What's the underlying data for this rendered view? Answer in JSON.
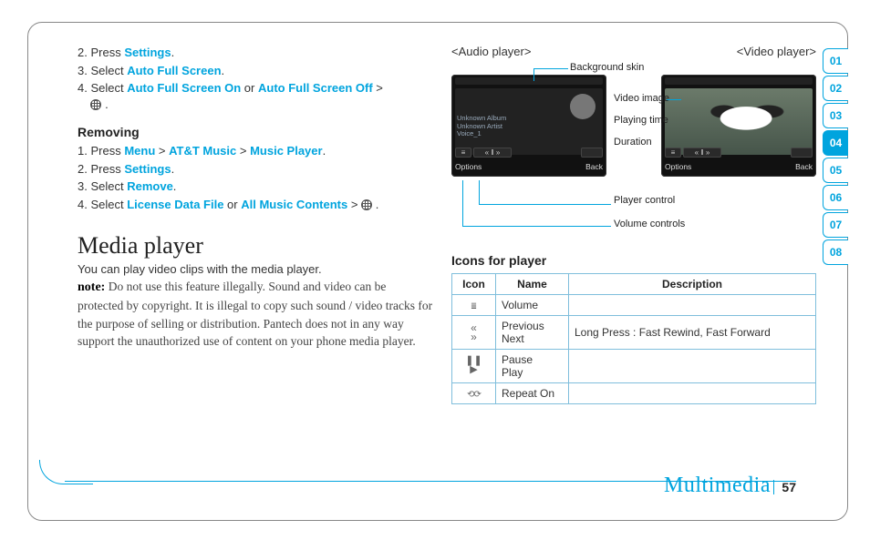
{
  "left": {
    "steps_top": [
      {
        "num": "2.",
        "pre": "Press ",
        "b1": "Settings",
        "post": "."
      },
      {
        "num": "3.",
        "pre": "Select ",
        "b1": "Auto Full Screen",
        "post": "."
      },
      {
        "num": "4.",
        "pre": "Select ",
        "b1": "Auto Full Screen On",
        "mid": " or ",
        "b2": "Auto Full Screen Off",
        "post": " > ",
        "globe": true
      }
    ],
    "removing_head": "Removing",
    "steps_removing": [
      {
        "num": "1.",
        "pre": "Press ",
        "b1": "Menu",
        "mid": " > ",
        "b2": "AT&T Music",
        "mid2": " > ",
        "b3": "Music Player",
        "post": "."
      },
      {
        "num": "2.",
        "pre": "Press ",
        "b1": "Settings",
        "post": "."
      },
      {
        "num": "3.",
        "pre": "Select ",
        "b1": "Remove",
        "post": "."
      },
      {
        "num": "4.",
        "pre": "Select ",
        "b1": "License Data File",
        "mid": " or ",
        "b2": "All Music Contents",
        "post": " > ",
        "globe": true
      }
    ],
    "h1": "Media player",
    "intro": "You can play video clips with the media player.",
    "note_lead": "note:",
    "note_body": " Do not use this feature illegally. Sound and video can be protected by copyright. It is illegal to copy such sound / video tracks for the purpose of selling or distribution. Pantech does not in any way support the unauthorized use of content on your phone media player."
  },
  "right": {
    "label_audio": "<Audio player>",
    "label_video": "<Video player>",
    "phone_audio": {
      "line1": "Unknown Album",
      "line2": "Unknown Artist",
      "line3": "Voice_1",
      "left": "Options",
      "right": "Back"
    },
    "phone_video": {
      "left": "Options",
      "right": "Back"
    },
    "callouts": {
      "bgskin": "Background skin",
      "vimg": "Video image",
      "ptime": "Playing time",
      "dur": "Duration",
      "pctrl": "Player control",
      "vctrl": "Volume controls"
    },
    "icons_head": "Icons for player",
    "table": {
      "h_icon": "Icon",
      "h_name": "Name",
      "h_desc": "Description",
      "rows": [
        {
          "icon": "volume",
          "name": "Volume",
          "desc": ""
        },
        {
          "icon": "prevnext",
          "name": "Previous\nNext",
          "desc": "Long Press : Fast Rewind, Fast Forward"
        },
        {
          "icon": "pauseplay",
          "name": "Pause\nPlay",
          "desc": ""
        },
        {
          "icon": "repeat",
          "name": "Repeat On",
          "desc": ""
        }
      ]
    }
  },
  "tabs": [
    "01",
    "02",
    "03",
    "04",
    "05",
    "06",
    "07",
    "08"
  ],
  "active_tab": "04",
  "footer_label": "Multimedia",
  "page_number": "57"
}
